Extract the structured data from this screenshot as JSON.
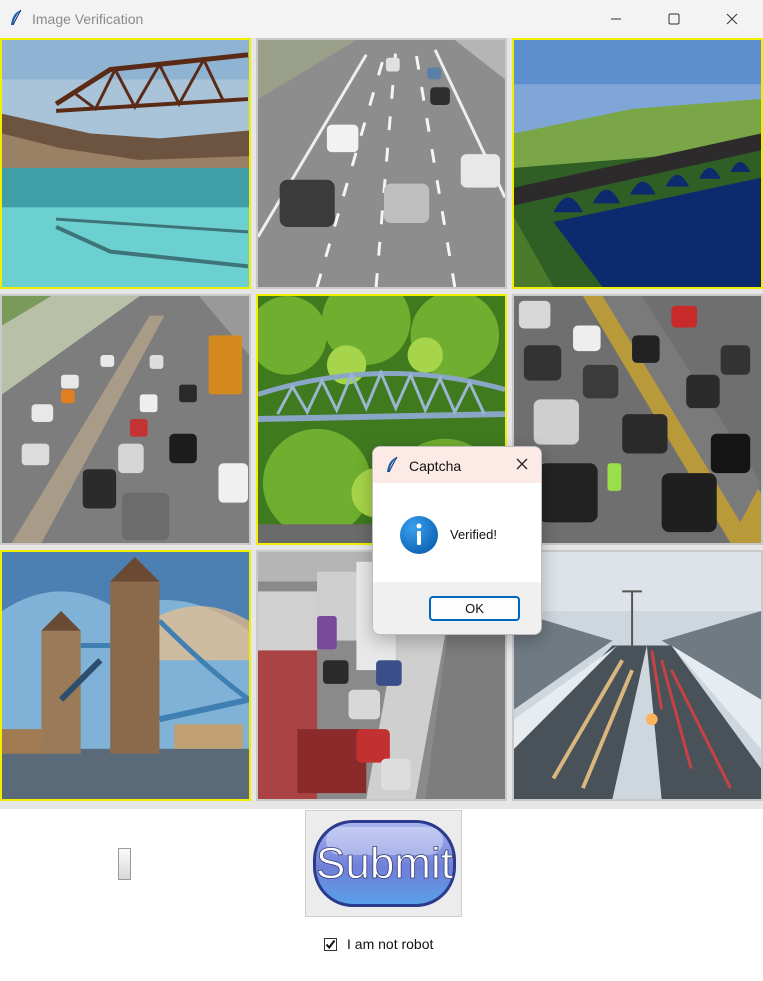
{
  "window": {
    "title": "Image Verification",
    "icon": "feather-icon",
    "controls": [
      "minimize-icon",
      "maximize-icon",
      "close-icon"
    ]
  },
  "grid": {
    "selection_color": "#f2ee00",
    "tiles": [
      {
        "row": 1,
        "col": 1,
        "subject": "bridge",
        "selected": true
      },
      {
        "row": 1,
        "col": 2,
        "subject": "highway",
        "selected": false
      },
      {
        "row": 1,
        "col": 3,
        "subject": "bridge",
        "selected": true
      },
      {
        "row": 2,
        "col": 1,
        "subject": "highway",
        "selected": false
      },
      {
        "row": 2,
        "col": 2,
        "subject": "bridge",
        "selected": true
      },
      {
        "row": 2,
        "col": 3,
        "subject": "highway",
        "selected": false
      },
      {
        "row": 3,
        "col": 1,
        "subject": "bridge",
        "selected": true
      },
      {
        "row": 3,
        "col": 2,
        "subject": "highway",
        "selected": false
      },
      {
        "row": 3,
        "col": 3,
        "subject": "highway",
        "selected": false
      }
    ]
  },
  "submit": {
    "label": "Submit"
  },
  "robot_check": {
    "label": "I am not robot",
    "checked": true
  },
  "dialog": {
    "title": "Captcha",
    "message": "Verified!",
    "icon": "info-icon",
    "ok_label": "OK"
  }
}
